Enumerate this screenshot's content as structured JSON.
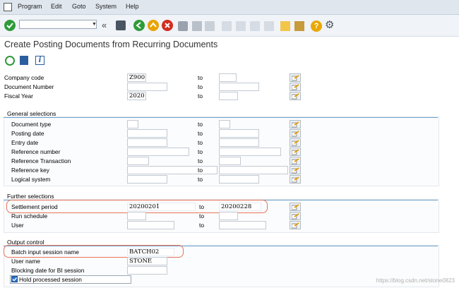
{
  "menu": [
    "Program",
    "Edit",
    "Goto",
    "System",
    "Help"
  ],
  "toolbar": {
    "command_value": ""
  },
  "title": "Create Posting Documents from Recurring Documents",
  "to_label": "to",
  "fields_top": [
    {
      "label": "Company code",
      "from": "Z900",
      "to": ""
    },
    {
      "label": "Document Number",
      "from": "",
      "to": ""
    },
    {
      "label": "Fiscal Year",
      "from": "2020",
      "to": ""
    }
  ],
  "general": {
    "title": "General selections",
    "fields": [
      {
        "label": "Document type",
        "from": "",
        "to": ""
      },
      {
        "label": "Posting date",
        "from": "",
        "to": ""
      },
      {
        "label": "Entry date",
        "from": "",
        "to": ""
      },
      {
        "label": "Reference number",
        "from": "",
        "to": ""
      },
      {
        "label": "Reference Transaction",
        "from": "",
        "to": ""
      },
      {
        "label": "Reference key",
        "from": "",
        "to": ""
      },
      {
        "label": "Logical system",
        "from": "",
        "to": ""
      }
    ]
  },
  "further": {
    "title": "Further selections",
    "fields": [
      {
        "label": "Settlement period",
        "from": "20200201",
        "to": "20200228"
      },
      {
        "label": "Run schedule",
        "from": "",
        "to": ""
      },
      {
        "label": "User",
        "from": "",
        "to": ""
      }
    ]
  },
  "output": {
    "title": "Output control",
    "fields": [
      {
        "label": "Batch input session name",
        "value": "BATCH02"
      },
      {
        "label": "User name",
        "value": "STONE"
      },
      {
        "label": "Blocking date for BI session",
        "value": ""
      }
    ],
    "checkbox_label": "Hold processed session",
    "checkbox_checked": true
  },
  "watermark": "https://blog.csdn.net/stone0823",
  "colors": {
    "accent": "#6fa2cf",
    "highlight": "#e8735a"
  }
}
